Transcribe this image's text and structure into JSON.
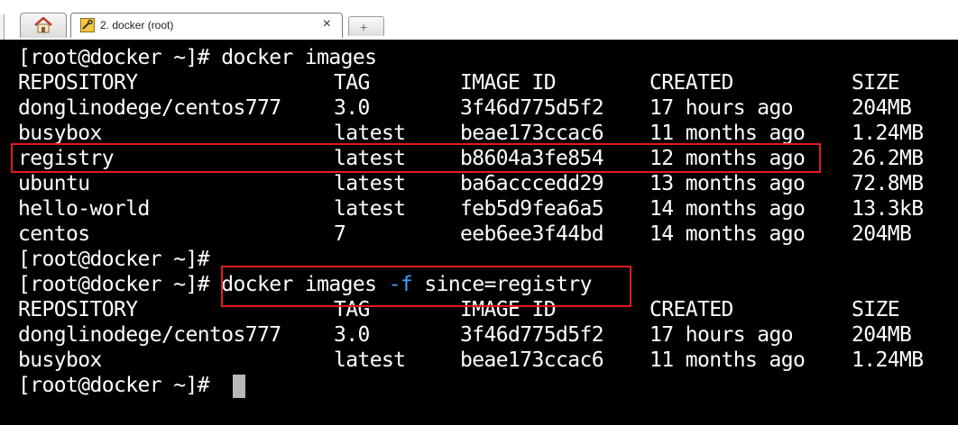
{
  "window": {
    "tab_title": "2. docker (root)",
    "home_icon": "home-icon",
    "tab_icon": "terminal-tool-icon",
    "close_glyph": "×",
    "new_tab_glyph": "+"
  },
  "terminal": {
    "lines": [
      {
        "prompt": "[root@docker ~]#",
        "command": "docker images"
      },
      {
        "cols": [
          "REPOSITORY",
          "TAG",
          "IMAGE ID",
          "CREATED",
          "SIZE"
        ]
      },
      {
        "cols": [
          "donglinodege/centos777",
          "3.0",
          "3f46d775d5f2",
          "17 hours ago",
          "204MB"
        ]
      },
      {
        "cols": [
          "busybox",
          "latest",
          "beae173ccac6",
          "11 months ago",
          "1.24MB"
        ]
      },
      {
        "cols": [
          "registry",
          "latest",
          "b8604a3fe854",
          "12 months ago",
          "26.2MB"
        ]
      },
      {
        "cols": [
          "ubuntu",
          "latest",
          "ba6acccedd29",
          "13 months ago",
          "72.8MB"
        ]
      },
      {
        "cols": [
          "hello-world",
          "latest",
          "feb5d9fea6a5",
          "14 months ago",
          "13.3kB"
        ]
      },
      {
        "cols": [
          "centos",
          "7",
          "eeb6ee3f44bd",
          "14 months ago",
          "204MB"
        ]
      },
      {
        "prompt": "[root@docker ~]#",
        "command": ""
      },
      {
        "prompt": "[root@docker ~]#",
        "command_parts": [
          "docker images ",
          "-f",
          " since=registry"
        ]
      },
      {
        "cols": [
          "REPOSITORY",
          "TAG",
          "IMAGE ID",
          "CREATED",
          "SIZE"
        ]
      },
      {
        "cols": [
          "donglinodege/centos777",
          "3.0",
          "3f46d775d5f2",
          "17 hours ago",
          "204MB"
        ]
      },
      {
        "cols": [
          "busybox",
          "latest",
          "beae173ccac6",
          "11 months ago",
          "1.24MB"
        ]
      },
      {
        "prompt": "[root@docker ~]#",
        "command": ""
      }
    ]
  },
  "colors": {
    "background": "#000000",
    "text": "#ffffff",
    "flag": "#3aa0ff",
    "highlight": "#e41b1b",
    "cursor": "#b8b8b8"
  }
}
